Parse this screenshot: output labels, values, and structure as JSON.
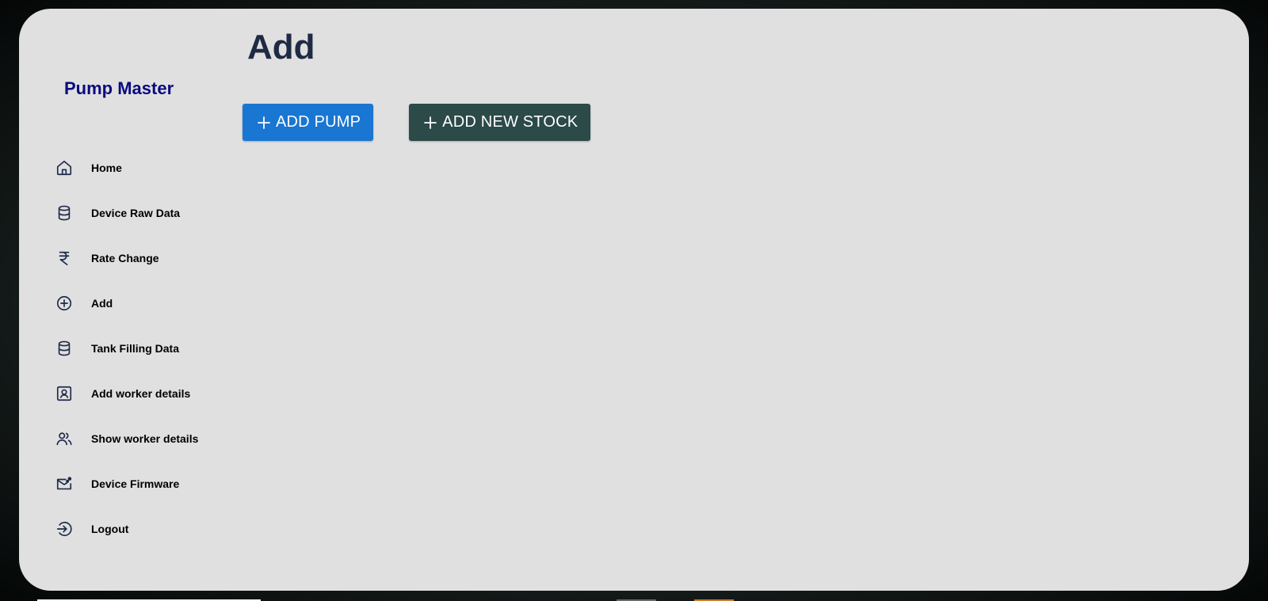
{
  "sidebar": {
    "brand": "Pump Master",
    "items": [
      {
        "label": "Home",
        "icon": "home-icon"
      },
      {
        "label": "Device Raw Data",
        "icon": "database-icon"
      },
      {
        "label": "Rate Change",
        "icon": "rupee-icon"
      },
      {
        "label": "Add",
        "icon": "plus-circle-icon"
      },
      {
        "label": "Tank Filling Data",
        "icon": "database-icon"
      },
      {
        "label": "Add worker details",
        "icon": "contact-card-icon"
      },
      {
        "label": "Show worker details",
        "icon": "users-icon"
      },
      {
        "label": "Device Firmware",
        "icon": "mail-update-icon"
      },
      {
        "label": "Logout",
        "icon": "logout-icon"
      }
    ]
  },
  "main": {
    "title": "Add",
    "buttons": {
      "add_pump": "ADD PUMP",
      "add_new_stock": "ADD NEW STOCK"
    }
  },
  "colors": {
    "brand": "#0a0a80",
    "primary_button": "#1976d2",
    "dark_button": "#2b4a48",
    "card_background": "#e0e0e0",
    "title": "#1f2a44"
  }
}
